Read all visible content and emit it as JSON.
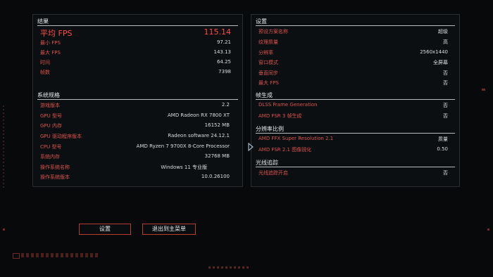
{
  "left": {
    "results": {
      "title": "结果",
      "avg_label": "平均 FPS",
      "avg_value": "115.14",
      "rows": [
        {
          "label": "最小 FPS",
          "value": "97.21"
        },
        {
          "label": "最大 FPS",
          "value": "143.13"
        },
        {
          "label": "时间",
          "value": "64.25"
        },
        {
          "label": "帧数",
          "value": "7398"
        }
      ]
    },
    "system": {
      "title": "系统规格",
      "rows": [
        {
          "label": "游戏版本",
          "value": "2.2"
        },
        {
          "label": "GPU 型号",
          "value": "AMD Radeon RX 7800 XT"
        },
        {
          "label": "GPU 内存",
          "value": "16152 MB"
        },
        {
          "label": "GPU 驱动程序版本",
          "value": "Radeon software 24.12.1"
        },
        {
          "label": "CPU 型号",
          "value": "AMD Ryzen 7 9700X 8-Core Processor"
        },
        {
          "label": "系统内存",
          "value": "32768 MB"
        },
        {
          "label": "操作系统名称",
          "value": "Windows 11 专业版"
        },
        {
          "label": "操作系统版本",
          "value": "10.0.26100"
        }
      ]
    }
  },
  "right": {
    "settings": {
      "title": "设置",
      "rows": [
        {
          "label": "预设方案名称",
          "value": "超级"
        },
        {
          "label": "纹理质量",
          "value": "高"
        },
        {
          "label": "分辨率",
          "value": "2560x1440"
        },
        {
          "label": "窗口模式",
          "value": "全屏幕"
        },
        {
          "label": "垂直同步",
          "value": "否"
        },
        {
          "label": "最大 FPS",
          "value": "否"
        }
      ]
    },
    "framegen": {
      "title": "帧生成",
      "rows": [
        {
          "label": "DLSS Frame Generation",
          "value": "否"
        },
        {
          "label": "AMD FSR 3 帧生成",
          "value": "否"
        }
      ]
    },
    "resolution_scaling": {
      "title": "分辨率比例",
      "rows": [
        {
          "label": "AMD FFX Super Resolution 2.1",
          "value": "质量"
        },
        {
          "label": "AMD FSR 2.1 图像锐化",
          "value": "0.50"
        }
      ]
    },
    "raytracing": {
      "title": "光线追踪",
      "rows": [
        {
          "label": "光线追踪开启",
          "value": "否"
        }
      ]
    }
  },
  "buttons": {
    "settings_label": "设置",
    "exit_label": "退出到主菜单"
  },
  "colors": {
    "accent_red": "#ff4b42",
    "label_red": "#d9524a",
    "value_white": "#dcdcdc",
    "button_border": "#b73a33"
  }
}
